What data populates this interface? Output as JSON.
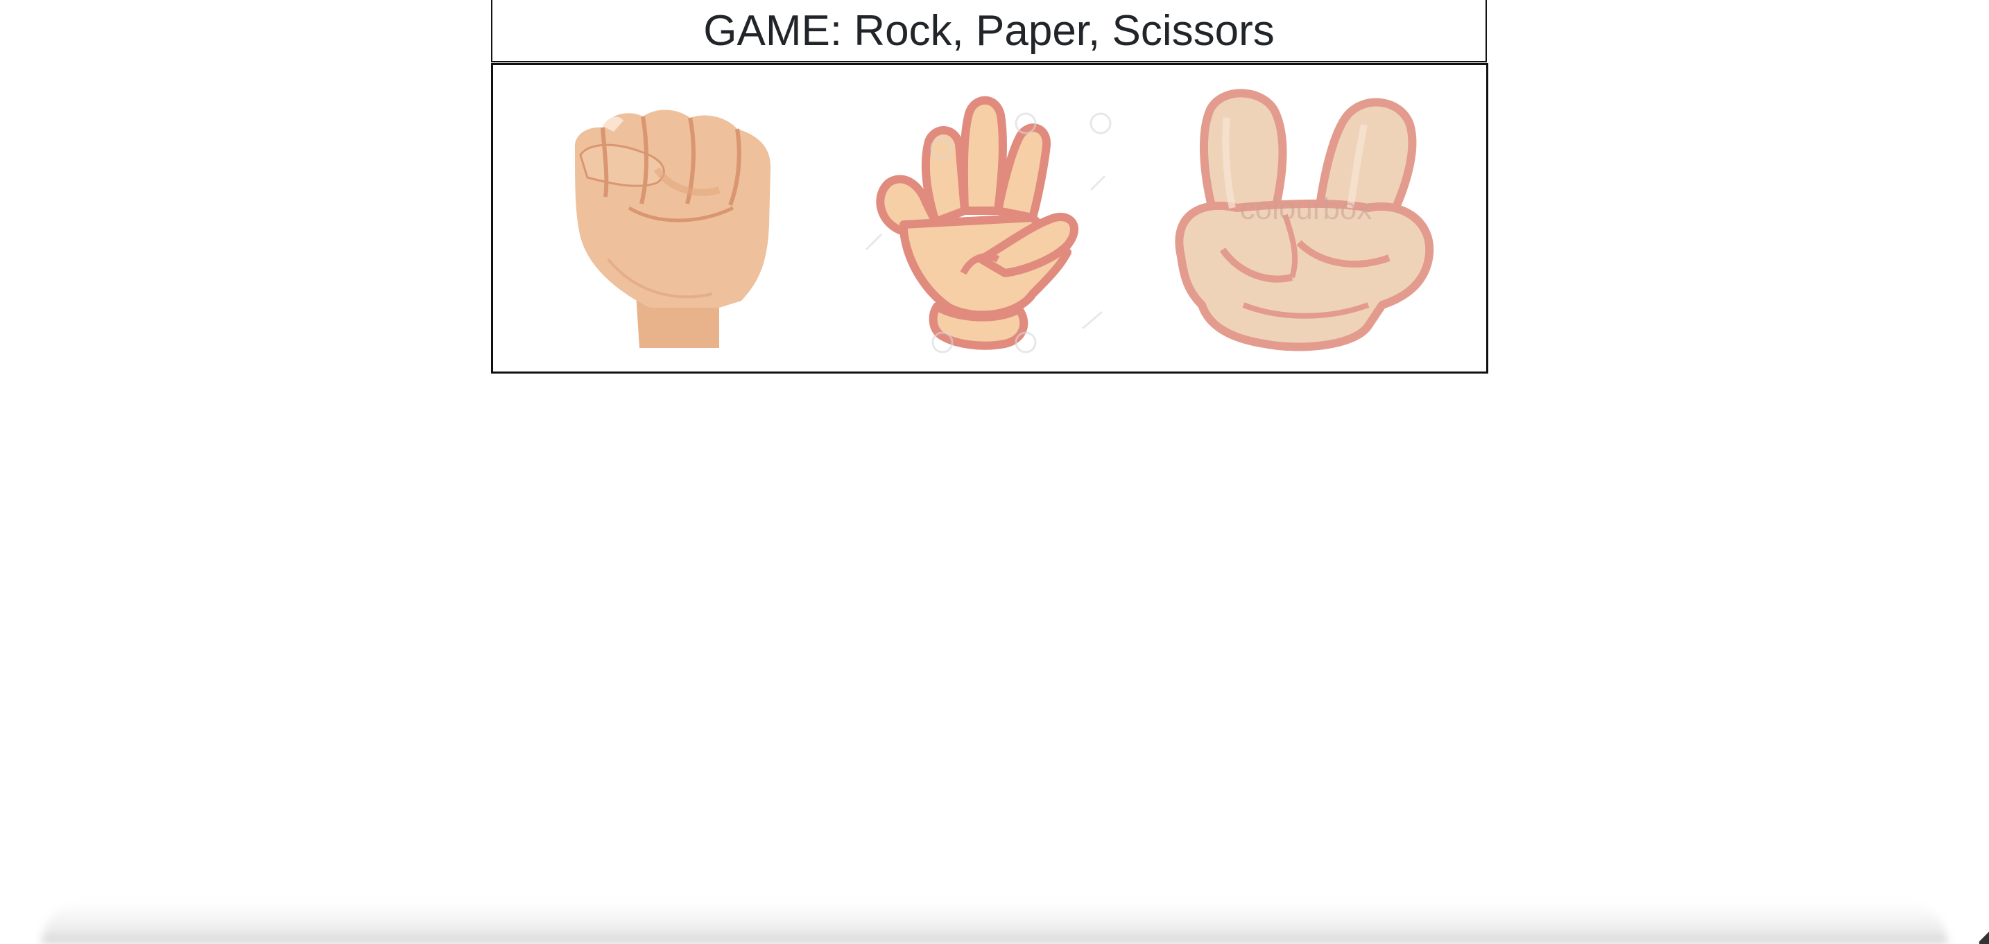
{
  "header": {
    "title": "GAME: Rock, Paper, Scissors"
  },
  "choices": [
    {
      "id": "rock",
      "icon": "rock-fist-icon"
    },
    {
      "id": "paper",
      "icon": "paper-open-hand-icon"
    },
    {
      "id": "scissors",
      "icon": "scissors-two-fingers-icon"
    }
  ],
  "images": {
    "scissors_watermark": "colourbox"
  },
  "colors": {
    "skin_light": "#f3caa2",
    "skin_mid": "#e8b28a",
    "skin_shadow": "#d99670",
    "outline_pink": "#e0968a",
    "border": "#111111",
    "title_text": "#212529"
  }
}
